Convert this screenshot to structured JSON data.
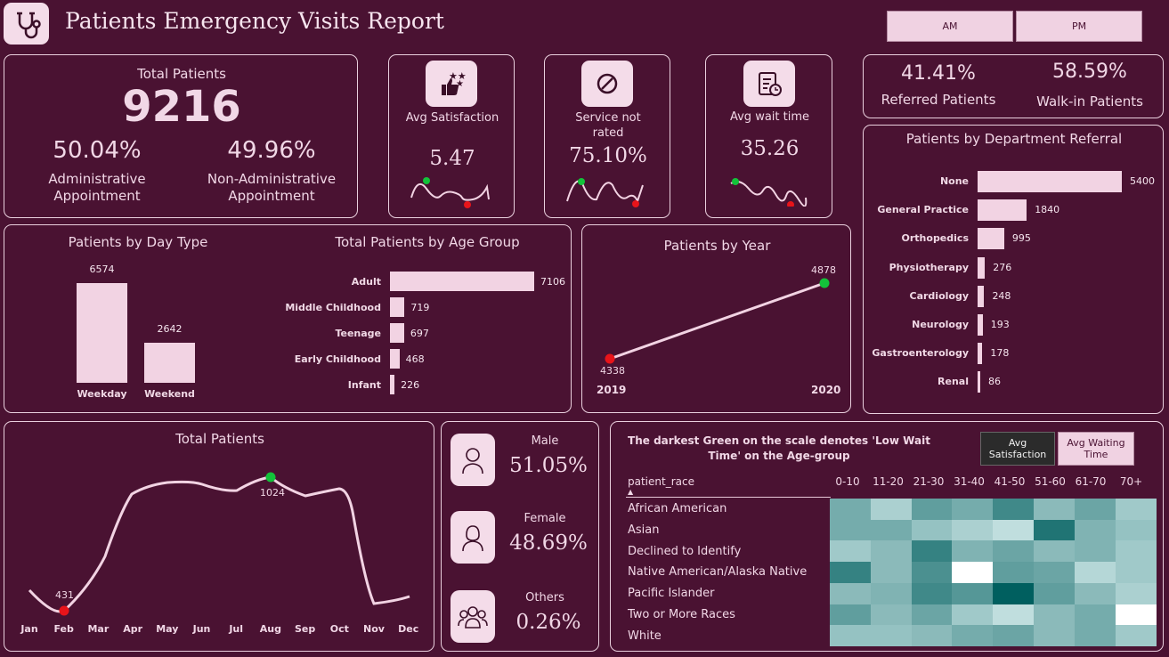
{
  "header": {
    "title": "Patients Emergency Visits Report",
    "am_label": "AM",
    "pm_label": "PM"
  },
  "totals": {
    "label": "Total Patients",
    "value": "9216",
    "admin_pct": "50.04%",
    "admin_label": "Administrative Appointment",
    "nonadmin_pct": "49.96%",
    "nonadmin_label": "Non-Administrative Appointment"
  },
  "kpis": {
    "satisfaction": {
      "label": "Avg Satisfaction",
      "value": "5.47"
    },
    "not_rated": {
      "label": "Service not rated",
      "value": "75.10%"
    },
    "wait": {
      "label": "Avg wait time",
      "value": "35.26"
    }
  },
  "referral": {
    "referred_pct": "41.41%",
    "referred_label": "Referred Patients",
    "walkin_pct": "58.59%",
    "walkin_label": "Walk-in Patients"
  },
  "department": {
    "title": "Patients by Department Referral",
    "items": [
      {
        "label": "None",
        "value": "5400"
      },
      {
        "label": "General Practice",
        "value": "1840"
      },
      {
        "label": "Orthopedics",
        "value": "995"
      },
      {
        "label": "Physiotherapy",
        "value": "276"
      },
      {
        "label": "Cardiology",
        "value": "248"
      },
      {
        "label": "Neurology",
        "value": "193"
      },
      {
        "label": "Gastroenterology",
        "value": "178"
      },
      {
        "label": "Renal",
        "value": "86"
      }
    ]
  },
  "day_type": {
    "title": "Patients by Day Type",
    "items": [
      {
        "label": "Weekday",
        "value": "6574"
      },
      {
        "label": "Weekend",
        "value": "2642"
      }
    ]
  },
  "age_group": {
    "title": "Total Patients by Age Group",
    "items": [
      {
        "label": "Adult",
        "value": "7106"
      },
      {
        "label": "Middle Childhood",
        "value": "719"
      },
      {
        "label": "Teenage",
        "value": "697"
      },
      {
        "label": "Early Childhood",
        "value": "468"
      },
      {
        "label": "Infant",
        "value": "226"
      }
    ]
  },
  "year": {
    "title": "Patients by Year",
    "points": [
      {
        "label": "2019",
        "value": "4338"
      },
      {
        "label": "2020",
        "value": "4878"
      }
    ]
  },
  "monthly": {
    "title": "Total Patients",
    "months": [
      "Jan",
      "Feb",
      "Mar",
      "Apr",
      "May",
      "Jun",
      "Jul",
      "Aug",
      "Sep",
      "Oct",
      "Nov",
      "Dec"
    ],
    "min_label": "431",
    "max_label": "1024"
  },
  "gender": {
    "male": {
      "label": "Male",
      "value": "51.05%"
    },
    "female": {
      "label": "Female",
      "value": "48.69%"
    },
    "others": {
      "label": "Others",
      "value": "0.26%"
    }
  },
  "heatmap": {
    "note": "The darkest Green on the scale denotes 'Low Wait Time' on the Age-group",
    "btn_satisfaction": "Avg Satisfaction",
    "btn_wait": "Avg Waiting Time",
    "row_header": "patient_race",
    "columns": [
      "0-10",
      "11-20",
      "21-30",
      "31-40",
      "41-50",
      "51-60",
      "61-70",
      "70+"
    ],
    "rows": [
      "African American",
      "Asian",
      "Declined to Identify",
      "Native American/Alaska Native",
      "Pacific Islander",
      "Two or More Races",
      "White"
    ]
  },
  "chart_data": [
    {
      "type": "bar",
      "title": "Patients by Department Referral",
      "categories": [
        "None",
        "General Practice",
        "Orthopedics",
        "Physiotherapy",
        "Cardiology",
        "Neurology",
        "Gastroenterology",
        "Renal"
      ],
      "values": [
        5400,
        1840,
        995,
        276,
        248,
        193,
        178,
        86
      ]
    },
    {
      "type": "bar",
      "title": "Patients by Day Type",
      "categories": [
        "Weekday",
        "Weekend"
      ],
      "values": [
        6574,
        2642
      ]
    },
    {
      "type": "bar",
      "title": "Total Patients by Age Group",
      "categories": [
        "Adult",
        "Middle Childhood",
        "Teenage",
        "Early Childhood",
        "Infant"
      ],
      "values": [
        7106,
        719,
        697,
        468,
        226
      ]
    },
    {
      "type": "line",
      "title": "Patients by Year",
      "x": [
        "2019",
        "2020"
      ],
      "values": [
        4338,
        4878
      ]
    },
    {
      "type": "line",
      "title": "Total Patients",
      "x": [
        "Jan",
        "Feb",
        "Mar",
        "Apr",
        "May",
        "Jun",
        "Jul",
        "Aug",
        "Sep",
        "Oct",
        "Nov",
        "Dec"
      ],
      "values": [
        530,
        431,
        600,
        950,
        990,
        985,
        950,
        1024,
        960,
        980,
        470,
        500
      ]
    },
    {
      "type": "heatmap",
      "x": [
        "0-10",
        "11-20",
        "21-30",
        "31-40",
        "41-50",
        "51-60",
        "61-70",
        "70+"
      ],
      "y": [
        "African American",
        "Asian",
        "Declined to Identify",
        "Native American/Alaska Native",
        "Pacific Islander",
        "Two or More Races",
        "White"
      ],
      "values": [
        [
          0.45,
          0.2,
          0.55,
          0.45,
          0.7,
          0.35,
          0.5,
          0.25
        ],
        [
          0.45,
          0.45,
          0.3,
          0.2,
          0.1,
          0.85,
          0.4,
          0.3
        ],
        [
          0.25,
          0.35,
          0.75,
          0.4,
          0.5,
          0.35,
          0.4,
          0.25
        ],
        [
          0.75,
          0.35,
          0.65,
          0.0,
          0.55,
          0.5,
          0.15,
          0.25
        ],
        [
          0.35,
          0.4,
          0.7,
          0.6,
          1.0,
          0.55,
          0.35,
          0.2
        ],
        [
          0.55,
          0.35,
          0.5,
          0.25,
          0.1,
          0.35,
          0.45,
          0.0
        ],
        [
          0.3,
          0.3,
          0.35,
          0.45,
          0.5,
          0.35,
          0.45,
          0.25
        ]
      ]
    }
  ],
  "colors": {
    "background": "#4a1232",
    "bar": "#f2d3e3",
    "high": "#13c23a",
    "low": "#e8141a",
    "teal_dark": "#005f5f"
  }
}
